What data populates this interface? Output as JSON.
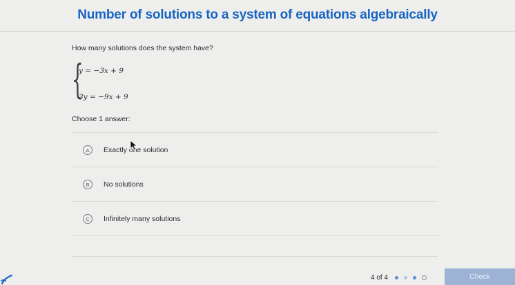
{
  "header": {
    "title": "Number of solutions to a system of equations algebraically"
  },
  "question": {
    "prompt": "How many solutions does the system have?",
    "equations": [
      "y = −3x + 9",
      "3y = −9x + 9"
    ],
    "choose_label": "Choose 1 answer:"
  },
  "options": [
    {
      "letter": "A",
      "label": "Exactly one solution"
    },
    {
      "letter": "B",
      "label": "No solutions"
    },
    {
      "letter": "C",
      "label": "Infinitely many solutions"
    }
  ],
  "footer": {
    "progress_text": "4 of 4",
    "check_label": "Check"
  },
  "colors": {
    "title": "#1865c4",
    "check_button": "#9db3d6",
    "progress_dot": "#5b8fd6",
    "logo": "#1865c4"
  }
}
